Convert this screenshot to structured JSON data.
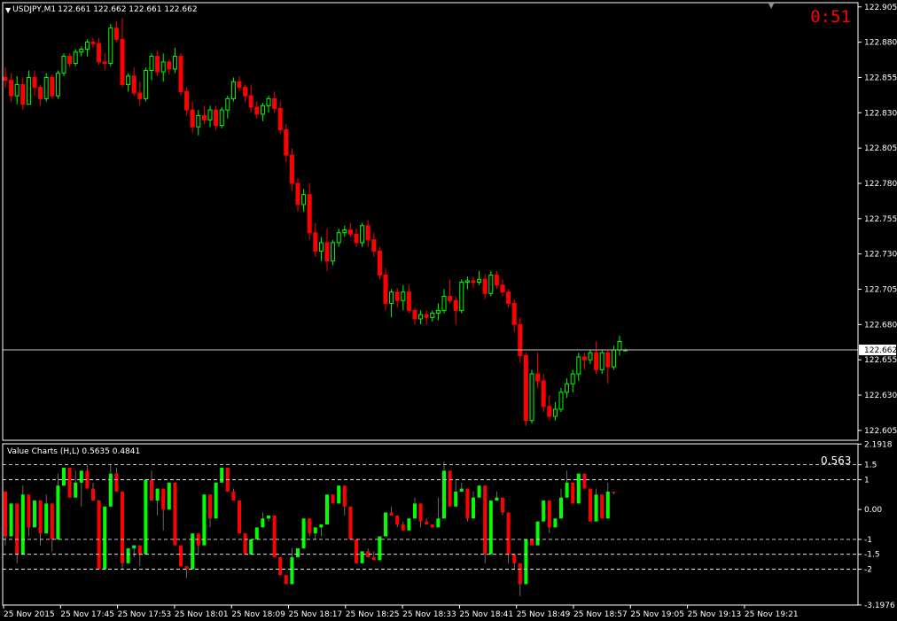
{
  "header": {
    "symbol": "USDJPY,M1",
    "ohlc": "122.661 122.662 122.661 122.662",
    "timer": "0:51",
    "menu_icon": "triangle-down-icon",
    "scroll_marker_icon": "triangle-down-icon"
  },
  "price_axis": {
    "ticks": [
      "122.905",
      "122.880",
      "122.855",
      "122.830",
      "122.805",
      "122.780",
      "122.755",
      "122.730",
      "122.705",
      "122.680",
      "122.655",
      "122.630",
      "122.605"
    ],
    "current_price": "122.662"
  },
  "indicator": {
    "title": "Value Charts (H,L) 0.5635 0.4841",
    "value": "0.563",
    "levels": [
      "2.1918",
      "1.5",
      "1",
      "0.00",
      "-1",
      "-1.5",
      "-2",
      "-3.1976"
    ]
  },
  "time_axis": {
    "labels": [
      "25 Nov 2015",
      "25 Nov 17:45",
      "25 Nov 17:53",
      "25 Nov 18:01",
      "25 Nov 18:09",
      "25 Nov 18:17",
      "25 Nov 18:25",
      "25 Nov 18:33",
      "25 Nov 18:41",
      "25 Nov 18:49",
      "25 Nov 18:57",
      "25 Nov 19:05",
      "25 Nov 19:13",
      "25 Nov 19:21"
    ]
  },
  "colors": {
    "background": "#000000",
    "bull": "#00ff00",
    "bear": "#ff0000",
    "grid": "#ffffff",
    "text": "#ffffff",
    "price_line": "#c0c0c0",
    "timer": "#ff0000"
  },
  "chart_data": {
    "type": "candlestick",
    "price_ohlc": [
      [
        122.855,
        122.862,
        122.848,
        122.853
      ],
      [
        122.853,
        122.858,
        122.838,
        122.842
      ],
      [
        122.842,
        122.856,
        122.836,
        122.85
      ],
      [
        122.85,
        122.855,
        122.832,
        122.836
      ],
      [
        122.836,
        122.86,
        122.836,
        122.855
      ],
      [
        122.855,
        122.86,
        122.842,
        122.848
      ],
      [
        122.848,
        122.85,
        122.835,
        122.84
      ],
      [
        122.84,
        122.858,
        122.838,
        122.855
      ],
      [
        122.855,
        122.857,
        122.84,
        122.842
      ],
      [
        122.842,
        122.86,
        122.84,
        122.858
      ],
      [
        122.858,
        122.872,
        122.856,
        122.87
      ],
      [
        122.87,
        122.872,
        122.862,
        122.865
      ],
      [
        122.865,
        122.875,
        122.863,
        122.873
      ],
      [
        122.873,
        122.877,
        122.87,
        122.875
      ],
      [
        122.875,
        122.882,
        122.87,
        122.88
      ],
      [
        122.88,
        122.883,
        122.876,
        122.879
      ],
      [
        122.879,
        122.883,
        122.864,
        122.866
      ],
      [
        122.866,
        122.872,
        122.86,
        122.865
      ],
      [
        122.865,
        122.893,
        122.863,
        122.89
      ],
      [
        122.89,
        122.895,
        122.88,
        122.882
      ],
      [
        122.882,
        122.897,
        122.848,
        122.85
      ],
      [
        122.85,
        122.858,
        122.845,
        122.856
      ],
      [
        122.856,
        122.862,
        122.842,
        122.844
      ],
      [
        122.844,
        122.852,
        122.835,
        122.84
      ],
      [
        122.84,
        122.862,
        122.838,
        122.86
      ],
      [
        122.86,
        122.872,
        122.853,
        122.87
      ],
      [
        122.87,
        122.874,
        122.856,
        122.859
      ],
      [
        122.859,
        122.872,
        122.852,
        122.866
      ],
      [
        122.866,
        122.868,
        122.857,
        122.861
      ],
      [
        122.861,
        122.876,
        122.858,
        122.87
      ],
      [
        122.87,
        122.872,
        122.842,
        122.845
      ],
      [
        122.845,
        122.848,
        122.828,
        122.832
      ],
      [
        122.832,
        122.838,
        122.816,
        122.82
      ],
      [
        122.82,
        122.832,
        122.814,
        122.828
      ],
      [
        122.828,
        122.835,
        122.822,
        122.825
      ],
      [
        122.825,
        122.835,
        122.82,
        122.832
      ],
      [
        122.832,
        122.835,
        122.818,
        122.821
      ],
      [
        122.821,
        122.834,
        122.819,
        122.832
      ],
      [
        122.832,
        122.842,
        122.826,
        122.84
      ],
      [
        122.84,
        122.855,
        122.838,
        122.852
      ],
      [
        122.852,
        122.856,
        122.845,
        122.848
      ],
      [
        122.848,
        122.85,
        122.838,
        122.842
      ],
      [
        122.842,
        122.85,
        122.83,
        122.834
      ],
      [
        122.834,
        122.838,
        122.826,
        122.829
      ],
      [
        122.829,
        122.837,
        122.824,
        122.835
      ],
      [
        122.835,
        122.842,
        122.83,
        122.84
      ],
      [
        122.84,
        122.845,
        122.83,
        122.833
      ],
      [
        122.833,
        122.838,
        122.815,
        122.818
      ],
      [
        122.818,
        122.822,
        122.795,
        122.8
      ],
      [
        122.8,
        122.805,
        122.775,
        122.78
      ],
      [
        122.78,
        122.784,
        122.76,
        122.765
      ],
      [
        122.765,
        122.776,
        122.76,
        122.772
      ],
      [
        122.772,
        122.78,
        122.74,
        122.745
      ],
      [
        122.745,
        122.752,
        122.728,
        122.732
      ],
      [
        122.732,
        122.742,
        122.725,
        122.738
      ],
      [
        122.738,
        122.748,
        122.718,
        122.725
      ],
      [
        122.725,
        122.74,
        122.722,
        122.738
      ],
      [
        122.738,
        122.748,
        122.735,
        122.745
      ],
      [
        122.745,
        122.75,
        122.742,
        122.747
      ],
      [
        122.747,
        122.752,
        122.742,
        122.744
      ],
      [
        122.744,
        122.748,
        122.735,
        122.738
      ],
      [
        122.738,
        122.752,
        122.735,
        122.75
      ],
      [
        122.75,
        122.754,
        122.735,
        122.74
      ],
      [
        122.74,
        122.745,
        122.728,
        122.732
      ],
      [
        122.732,
        122.735,
        122.712,
        122.715
      ],
      [
        122.715,
        122.72,
        122.69,
        122.695
      ],
      [
        122.695,
        122.705,
        122.685,
        122.703
      ],
      [
        122.703,
        122.706,
        122.692,
        122.697
      ],
      [
        122.697,
        122.708,
        122.69,
        122.703
      ],
      [
        122.703,
        122.708,
        122.688,
        122.69
      ],
      [
        122.69,
        122.692,
        122.68,
        122.684
      ],
      [
        122.684,
        122.69,
        122.68,
        122.687
      ],
      [
        122.687,
        122.69,
        122.68,
        122.685
      ],
      [
        122.685,
        122.69,
        122.682,
        122.688
      ],
      [
        122.688,
        122.695,
        122.683,
        122.69
      ],
      [
        122.69,
        122.705,
        122.688,
        122.7
      ],
      [
        122.7,
        122.712,
        122.695,
        122.697
      ],
      [
        122.697,
        122.7,
        122.68,
        122.69
      ],
      [
        122.69,
        122.712,
        122.688,
        122.71
      ],
      [
        122.71,
        122.714,
        122.705,
        122.711
      ],
      [
        122.711,
        122.714,
        122.706,
        122.71
      ],
      [
        122.71,
        122.718,
        122.708,
        122.712
      ],
      [
        122.712,
        122.716,
        122.698,
        122.702
      ],
      [
        122.702,
        122.718,
        122.7,
        122.715
      ],
      [
        122.715,
        122.718,
        122.705,
        122.708
      ],
      [
        122.708,
        122.712,
        122.7,
        122.703
      ],
      [
        122.703,
        122.705,
        122.692,
        122.695
      ],
      [
        122.695,
        122.698,
        122.675,
        122.68
      ],
      [
        122.68,
        122.685,
        122.653,
        122.658
      ],
      [
        122.658,
        122.66,
        122.608,
        122.612
      ],
      [
        122.612,
        122.648,
        122.61,
        122.645
      ],
      [
        122.645,
        122.66,
        122.635,
        122.64
      ],
      [
        122.64,
        122.645,
        122.618,
        122.622
      ],
      [
        122.622,
        122.63,
        122.612,
        122.615
      ],
      [
        122.615,
        122.625,
        122.612,
        122.62
      ],
      [
        122.62,
        122.635,
        122.618,
        122.632
      ],
      [
        122.632,
        122.642,
        122.628,
        122.638
      ],
      [
        122.638,
        122.648,
        122.632,
        122.645
      ],
      [
        122.645,
        122.66,
        122.64,
        122.657
      ],
      [
        122.657,
        122.66,
        122.648,
        122.655
      ],
      [
        122.655,
        122.662,
        122.652,
        122.66
      ],
      [
        122.66,
        122.668,
        122.645,
        122.648
      ],
      [
        122.648,
        122.662,
        122.645,
        122.66
      ],
      [
        122.66,
        122.662,
        122.638,
        122.65
      ],
      [
        122.65,
        122.665,
        122.648,
        122.662
      ],
      [
        122.662,
        122.672,
        122.658,
        122.668
      ],
      [
        122.662,
        122.663,
        122.661,
        122.662
      ]
    ],
    "indicator_values": [
      [
        0.6,
        -1.2,
        -0.9
      ],
      [
        -0.9,
        -0.5,
        0.2
      ],
      [
        0.2,
        -1.8,
        -1.5
      ],
      [
        -1.5,
        0.8,
        0.5
      ],
      [
        0.5,
        -0.9,
        -0.6
      ],
      [
        -0.6,
        0.0,
        0.3
      ],
      [
        0.3,
        -1.2,
        -0.8
      ],
      [
        -0.8,
        0.5,
        0.2
      ],
      [
        0.2,
        -1.4,
        -1.0
      ],
      [
        -1.0,
        1.2,
        0.8
      ],
      [
        0.8,
        1.0,
        1.4
      ],
      [
        1.4,
        1.1,
        0.4
      ],
      [
        0.4,
        1.3,
        0.9
      ],
      [
        0.9,
        0.1,
        1.3
      ],
      [
        1.3,
        1.5,
        0.7
      ],
      [
        0.7,
        0.9,
        0.3
      ],
      [
        0.3,
        -1.9,
        -2.0
      ],
      [
        -2.0,
        -0.3,
        0.1
      ],
      [
        0.1,
        1.5,
        1.2
      ],
      [
        1.2,
        1.4,
        0.6
      ],
      [
        0.6,
        -2.0,
        -1.8
      ],
      [
        -1.8,
        -1.6,
        -1.3
      ],
      [
        -1.3,
        -1.6,
        -1.2
      ],
      [
        -1.2,
        -1.9,
        -1.5
      ],
      [
        -1.5,
        0.4,
        1.0
      ],
      [
        1.0,
        1.3,
        0.3
      ],
      [
        0.3,
        -0.2,
        0.7
      ],
      [
        0.7,
        -0.7,
        0.0
      ],
      [
        0.0,
        0.5,
        0.9
      ],
      [
        0.9,
        -0.9,
        -1.2
      ],
      [
        -1.2,
        -1.8,
        -1.9
      ],
      [
        -1.9,
        -2.3,
        -2.0
      ],
      [
        -2.0,
        -1.0,
        -0.8
      ],
      [
        -0.8,
        -1.5,
        -1.2
      ],
      [
        -1.2,
        0.2,
        0.5
      ],
      [
        0.5,
        -0.6,
        -0.3
      ],
      [
        -0.3,
        0.5,
        0.9
      ],
      [
        0.9,
        1.1,
        1.4
      ],
      [
        1.4,
        1.2,
        0.6
      ],
      [
        0.6,
        0.7,
        0.3
      ],
      [
        0.3,
        -0.5,
        -0.8
      ],
      [
        -0.8,
        -1.2,
        -1.5
      ],
      [
        -1.5,
        -1.4,
        -1.0
      ],
      [
        -1.0,
        -0.8,
        -0.6
      ],
      [
        -0.6,
        -0.1,
        -0.3
      ],
      [
        -0.3,
        -0.4,
        -0.2
      ],
      [
        -0.2,
        -1.3,
        -1.6
      ],
      [
        -1.6,
        -2.0,
        -2.2
      ],
      [
        -2.2,
        -2.4,
        -2.5
      ],
      [
        -2.5,
        -1.3,
        -1.6
      ],
      [
        -1.6,
        -1.5,
        -1.3
      ],
      [
        -1.3,
        -0.5,
        -0.3
      ],
      [
        -0.3,
        -0.9,
        -0.8
      ],
      [
        -0.8,
        -1.0,
        -0.6
      ],
      [
        -0.6,
        -0.9,
        -0.5
      ],
      [
        -0.5,
        0.2,
        0.5
      ],
      [
        0.5,
        0.4,
        0.2
      ],
      [
        0.2,
        0.6,
        0.8
      ],
      [
        0.8,
        -0.2,
        0.1
      ],
      [
        0.1,
        -0.7,
        -1.0
      ],
      [
        -1.0,
        -1.6,
        -1.8
      ],
      [
        -1.8,
        -1.5,
        -1.4
      ],
      [
        -1.4,
        -1.3,
        -1.6
      ],
      [
        -1.6,
        -1.4,
        -1.7
      ],
      [
        -1.7,
        -1.0,
        -0.9
      ],
      [
        -0.9,
        -0.3,
        -0.1
      ],
      [
        -0.1,
        0.1,
        -0.2
      ],
      [
        -0.2,
        -0.6,
        -0.5
      ],
      [
        -0.5,
        -0.4,
        -0.7
      ],
      [
        -0.7,
        -0.4,
        -0.3
      ],
      [
        -0.3,
        0.4,
        0.2
      ],
      [
        0.2,
        -0.6,
        -0.4
      ],
      [
        -0.4,
        -0.3,
        -0.5
      ],
      [
        -0.5,
        -0.5,
        -0.6
      ],
      [
        -0.6,
        0.4,
        -0.3
      ],
      [
        -0.3,
        1.6,
        1.3
      ],
      [
        1.3,
        0.6,
        0.1
      ],
      [
        0.1,
        1.0,
        0.6
      ],
      [
        0.6,
        0.9,
        0.7
      ],
      [
        0.7,
        -0.4,
        -0.3
      ],
      [
        -0.3,
        0.6,
        0.4
      ],
      [
        0.4,
        0.7,
        0.8
      ],
      [
        0.8,
        -1.8,
        -1.5
      ],
      [
        -1.5,
        0.0,
        0.3
      ],
      [
        0.3,
        0.6,
        0.4
      ],
      [
        0.4,
        -0.2,
        -0.1
      ],
      [
        -0.1,
        -1.8,
        -1.5
      ],
      [
        -1.5,
        -2.0,
        -1.8
      ],
      [
        -1.8,
        -2.9,
        -2.5
      ],
      [
        -2.5,
        -1.3,
        -1.0
      ],
      [
        -1.0,
        -1.1,
        -1.2
      ],
      [
        -1.2,
        -0.6,
        -0.4
      ],
      [
        -0.4,
        -0.1,
        0.3
      ],
      [
        0.3,
        -0.8,
        -0.6
      ],
      [
        -0.6,
        -0.5,
        -0.3
      ],
      [
        -0.3,
        0.7,
        0.4
      ],
      [
        0.4,
        1.3,
        0.9
      ],
      [
        0.9,
        0.8,
        0.2
      ],
      [
        0.2,
        1.0,
        1.2
      ],
      [
        1.2,
        1.1,
        0.7
      ],
      [
        0.7,
        0.2,
        -0.4
      ],
      [
        -0.4,
        0.7,
        0.5
      ],
      [
        0.5,
        0.0,
        -0.3
      ],
      [
        -0.3,
        0.9,
        0.6
      ],
      [
        0.6,
        0.5,
        0.56
      ]
    ]
  }
}
